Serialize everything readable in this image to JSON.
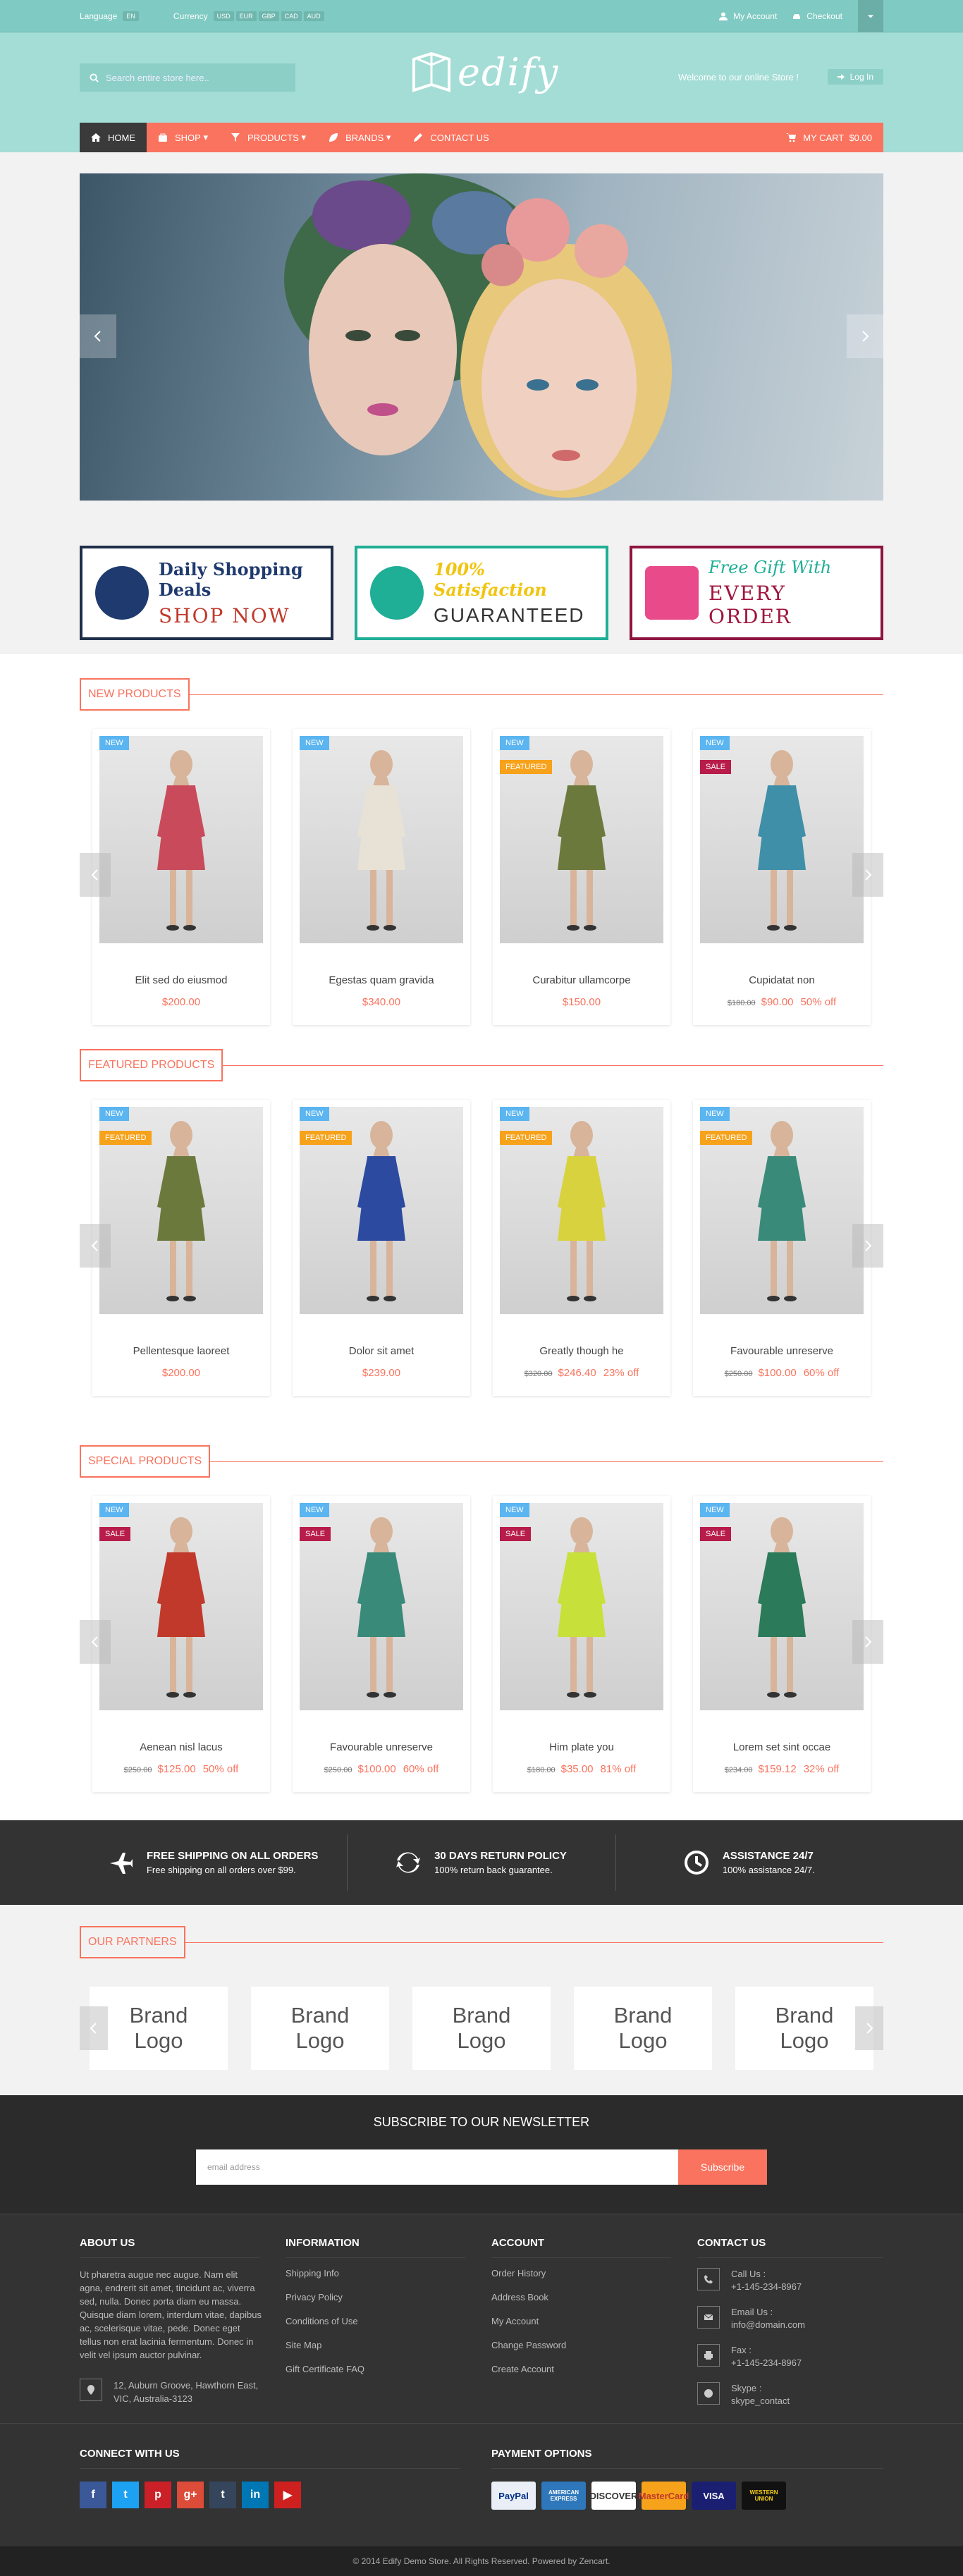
{
  "topbar": {
    "language_label": "Language",
    "languages": [
      "EN"
    ],
    "currency_label": "Currency",
    "currencies": [
      "USD",
      "EUR",
      "GBP",
      "CAD",
      "AUD"
    ],
    "account": "My Account",
    "checkout": "Checkout"
  },
  "header": {
    "search_placeholder": "Search entire store here..",
    "logo_text": "edify",
    "welcome": "Welcome to our online Store !",
    "login": "Log In"
  },
  "nav": {
    "items": [
      "HOME",
      "SHOP",
      "PRODUCTS",
      "BRANDS",
      "CONTACT US"
    ],
    "cart": "MY CART",
    "cart_total": "$0.00"
  },
  "banners": [
    {
      "line1": "Daily Shopping Deals",
      "line2": "SHOP NOW",
      "color1": "#1f3a6e",
      "color2": "#c0392b",
      "border": "#1f2f4a"
    },
    {
      "line1": "100% Satisfaction",
      "line2": "GUARANTEED",
      "color1": "#f1c40f",
      "color2": "#333333",
      "border": "#1fae96"
    },
    {
      "line1": "Free Gift With",
      "line2": "EVERY ORDER",
      "color1": "#1fae96",
      "color2": "#a0153e",
      "border": "#8e1540"
    }
  ],
  "new_products": {
    "title": "NEW PRODUCTS",
    "items": [
      {
        "name": "Elit sed do eiusmod",
        "price": "$200.00",
        "old": "",
        "disc": "",
        "badges": [
          "NEW"
        ],
        "dress": "#c94a5a"
      },
      {
        "name": "Egestas quam gravida",
        "price": "$340.00",
        "old": "",
        "disc": "",
        "badges": [
          "NEW"
        ],
        "dress": "#e8e2d6"
      },
      {
        "name": "Curabitur ullamcorpe",
        "price": "$150.00",
        "old": "",
        "disc": "",
        "badges": [
          "NEW",
          "FEATURED"
        ],
        "dress": "#6b7a3c"
      },
      {
        "name": "Cupidatat non",
        "price": "$90.00",
        "old": "$180.00",
        "disc": "50% off",
        "badges": [
          "NEW",
          "SALE"
        ],
        "dress": "#3f8fa8"
      }
    ]
  },
  "featured_products": {
    "title": "FEATURED PRODUCTS",
    "items": [
      {
        "name": "Pellentesque laoreet",
        "price": "$200.00",
        "old": "",
        "disc": "",
        "badges": [
          "NEW",
          "FEATURED"
        ],
        "dress": "#6b7a3c"
      },
      {
        "name": "Dolor sit amet",
        "price": "$239.00",
        "old": "",
        "disc": "",
        "badges": [
          "NEW",
          "FEATURED"
        ],
        "dress": "#2c4aa0"
      },
      {
        "name": "Greatly though he",
        "price": "$246.40",
        "old": "$320.00",
        "disc": "23% off",
        "badges": [
          "NEW",
          "FEATURED"
        ],
        "dress": "#d9d23f"
      },
      {
        "name": "Favourable unreserve",
        "price": "$100.00",
        "old": "$250.00",
        "disc": "60% off",
        "badges": [
          "NEW",
          "FEATURED"
        ],
        "dress": "#3a8a7a"
      }
    ]
  },
  "special_products": {
    "title": "SPECIAL PRODUCTS",
    "items": [
      {
        "name": "Aenean nisl lacus",
        "price": "$125.00",
        "old": "$250.00",
        "disc": "50% off",
        "badges": [
          "NEW",
          "SALE"
        ],
        "dress": "#c0392b"
      },
      {
        "name": "Favourable unreserve",
        "price": "$100.00",
        "old": "$250.00",
        "disc": "60% off",
        "badges": [
          "NEW",
          "SALE"
        ],
        "dress": "#3a8a7a"
      },
      {
        "name": "Him plate you",
        "price": "$35.00",
        "old": "$180.00",
        "disc": "81% off",
        "badges": [
          "NEW",
          "SALE"
        ],
        "dress": "#c8e03a"
      },
      {
        "name": "Lorem set sint occae",
        "price": "$159.12",
        "old": "$234.00",
        "disc": "32% off",
        "badges": [
          "NEW",
          "SALE"
        ],
        "dress": "#2b7a5a"
      }
    ]
  },
  "features": [
    {
      "title": "FREE SHIPPING ON ALL ORDERS",
      "sub": "Free shipping on all orders over $99.",
      "icon": "plane-icon"
    },
    {
      "title": "30 DAYS RETURN POLICY",
      "sub": "100% return back guarantee.",
      "icon": "refresh-icon"
    },
    {
      "title": "ASSISTANCE 24/7",
      "sub": "100% assistance 24/7.",
      "icon": "clock-icon"
    }
  ],
  "partners": {
    "title": "OUR PARTNERS",
    "logos": [
      "Brand\nLogo",
      "Brand\nLogo",
      "Brand\nLogo",
      "Brand\nLogo",
      "Brand\nLogo"
    ]
  },
  "newsletter": {
    "title": "SUBSCRIBE TO OUR NEWSLETTER",
    "placeholder": "email address",
    "button": "Subscribe"
  },
  "footer": {
    "about_title": "ABOUT US",
    "about_text": "Ut pharetra augue nec augue. Nam elit agna, endrerit sit amet, tincidunt ac, viverra sed, nulla. Donec porta diam eu massa. Quisque diam lorem, interdum vitae, dapibus ac, scelerisque vitae, pede. Donec eget tellus non erat lacinia fermentum. Donec in velit vel ipsum auctor pulvinar.",
    "address": "12, Auburn Groove, Hawthorn East, VIC, Australia-3123",
    "info_title": "INFORMATION",
    "info_links": [
      "Shipping Info",
      "Privacy Policy",
      "Conditions of Use",
      "Site Map",
      "Gift Certificate FAQ"
    ],
    "account_title": "ACCOUNT",
    "account_links": [
      "Order History",
      "Address Book",
      "My Account",
      "Change Password",
      "Create Account"
    ],
    "contact_title": "CONTACT US",
    "contacts": [
      {
        "label": "Call Us :",
        "value": "+1-145-234-8967",
        "icon": "phone-icon"
      },
      {
        "label": "Email Us :",
        "value": "info@domain.com",
        "icon": "envelope-icon"
      },
      {
        "label": "Fax :",
        "value": "+1-145-234-8967",
        "icon": "fax-icon"
      },
      {
        "label": "Skype :",
        "value": "skype_contact",
        "icon": "skype-icon"
      }
    ],
    "connect_title": "CONNECT WITH US",
    "socials": [
      {
        "icon": "facebook-icon",
        "glyph": "f",
        "color": "#3b5998"
      },
      {
        "icon": "twitter-icon",
        "glyph": "t",
        "color": "#1da1f2"
      },
      {
        "icon": "pinterest-icon",
        "glyph": "p",
        "color": "#cb2027"
      },
      {
        "icon": "google-plus-icon",
        "glyph": "g+",
        "color": "#dd4b39"
      },
      {
        "icon": "tumblr-icon",
        "glyph": "t",
        "color": "#35465c"
      },
      {
        "icon": "linkedin-icon",
        "glyph": "in",
        "color": "#0077b5"
      },
      {
        "icon": "youtube-icon",
        "glyph": "▶",
        "color": "#cd201f"
      }
    ],
    "payment_title": "PAYMENT OPTIONS",
    "payments": [
      {
        "name": "PayPal",
        "bg": "#e9eef7",
        "fg": "#003087"
      },
      {
        "name": "AMERICAN EXPRESS",
        "bg": "#2e77bb",
        "fg": "#ffffff"
      },
      {
        "name": "DISCOVER",
        "bg": "#ffffff",
        "fg": "#333333"
      },
      {
        "name": "MasterCard",
        "bg": "#f7a21b",
        "fg": "#c0392b"
      },
      {
        "name": "VISA",
        "bg": "#1a1f71",
        "fg": "#ffffff"
      },
      {
        "name": "WESTERN UNION",
        "bg": "#111111",
        "fg": "#f7d117"
      }
    ],
    "copyright": "© 2014 Edify Demo Store. All Rights Reserved. Powered by Zencart."
  }
}
